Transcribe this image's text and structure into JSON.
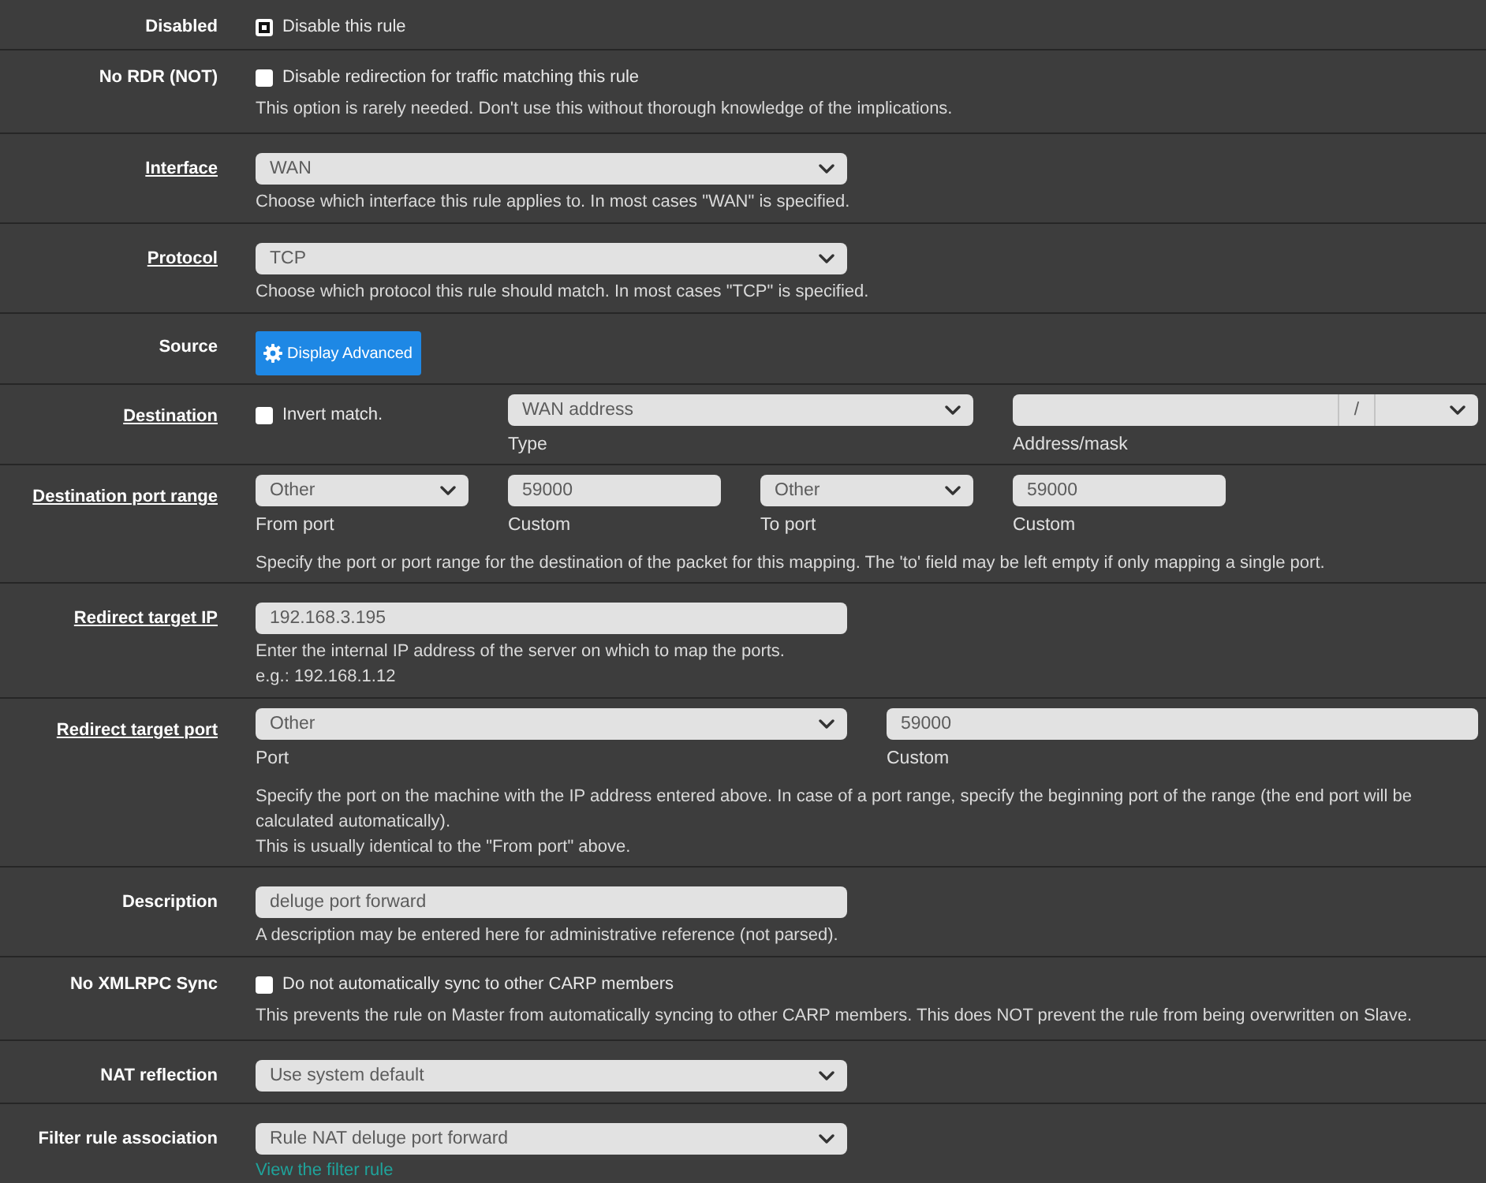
{
  "rows": [
    {
      "kind": "single",
      "label": "Disabled",
      "required": false,
      "fields": [
        {
          "kind": "checkbox",
          "label": "Disable this rule",
          "checked": true
        }
      ]
    },
    {
      "kind": "single",
      "label": "No RDR (NOT)",
      "required": false,
      "fields": [
        {
          "kind": "checkbox",
          "label": "Disable redirection for traffic matching this rule",
          "checked": false
        }
      ],
      "help": [
        "This option is rarely needed. Don't use this without thorough knowledge of the implications."
      ]
    },
    {
      "kind": "single",
      "label": "Interface",
      "required": true,
      "fields": [
        {
          "kind": "select",
          "value": "WAN"
        }
      ],
      "help": [
        "Choose which interface this rule applies to. In most cases \"WAN\" is specified."
      ]
    },
    {
      "kind": "single",
      "label": "Protocol",
      "required": true,
      "fields": [
        {
          "kind": "select",
          "value": "TCP"
        }
      ],
      "help": [
        "Choose which protocol this rule should match. In most cases \"TCP\" is specified."
      ]
    },
    {
      "kind": "single",
      "label": "Source",
      "required": false,
      "fields": [
        {
          "kind": "button",
          "label": "Display Advanced"
        }
      ]
    },
    {
      "kind": "destination",
      "label": "Destination",
      "required": true,
      "fields": [
        {
          "kind": "checkbox",
          "label": "Invert match.",
          "checked": false
        },
        {
          "kind": "select",
          "value": "WAN address",
          "caption": "Type"
        },
        {
          "kind": "address",
          "separator": "/",
          "caption": "Address/mask"
        }
      ]
    },
    {
      "kind": "quad",
      "label": "Destination port range",
      "required": true,
      "fields": [
        {
          "kind": "select",
          "value": "Other",
          "caption": "From port"
        },
        {
          "kind": "input",
          "value": "59000",
          "caption": "Custom"
        },
        {
          "kind": "select",
          "value": "Other",
          "caption": "To port"
        },
        {
          "kind": "input",
          "value": "59000",
          "caption": "Custom"
        }
      ],
      "help": [
        "Specify the port or port range for the destination of the packet for this mapping. The 'to' field may be left empty if only mapping a single port."
      ]
    },
    {
      "kind": "single",
      "label": "Redirect target IP",
      "required": true,
      "fields": [
        {
          "kind": "input",
          "value": "192.168.3.195"
        }
      ],
      "help": [
        "Enter the internal IP address of the server on which to map the ports.",
        "e.g.: 192.168.1.12"
      ]
    },
    {
      "kind": "pair",
      "label": "Redirect target port",
      "required": true,
      "fields": [
        {
          "kind": "select",
          "value": "Other",
          "caption": "Port"
        },
        {
          "kind": "input",
          "value": "59000",
          "caption": "Custom"
        }
      ],
      "help": [
        "Specify the port on the machine with the IP address entered above. In case of a port range, specify the beginning port of the range (the end port will be calculated automatically).",
        "This is usually identical to the \"From port\" above."
      ]
    },
    {
      "kind": "single",
      "label": "Description",
      "required": false,
      "fields": [
        {
          "kind": "input",
          "value": "deluge port forward"
        }
      ],
      "help": [
        "A description may be entered here for administrative reference (not parsed)."
      ]
    },
    {
      "kind": "single",
      "label": "No XMLRPC Sync",
      "required": false,
      "fields": [
        {
          "kind": "checkbox",
          "label": "Do not automatically sync to other CARP members",
          "checked": false
        }
      ],
      "help": [
        "This prevents the rule on Master from automatically syncing to other CARP members. This does NOT prevent the rule from being overwritten on Slave."
      ]
    },
    {
      "kind": "single",
      "label": "NAT reflection",
      "required": false,
      "fields": [
        {
          "kind": "select",
          "value": "Use system default"
        }
      ]
    },
    {
      "kind": "single",
      "label": "Filter rule association",
      "required": false,
      "fields": [
        {
          "kind": "select",
          "value": "Rule NAT deluge port forward"
        }
      ],
      "link": "View the filter rule"
    }
  ]
}
